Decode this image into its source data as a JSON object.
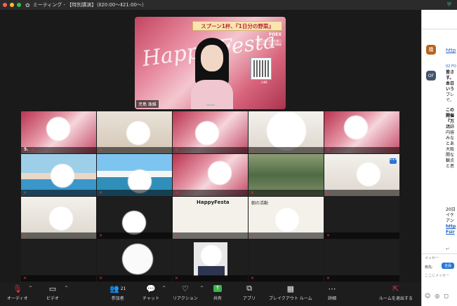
{
  "window": {
    "title": "ミーティング - 【特別講演】（Ⅱ20:00〜Ⅱ21:00〜）"
  },
  "speaker": {
    "banner": "スプーン1杯、『1日分の野菜』",
    "script_text": "Happy Festa",
    "brand": "FOEX",
    "dates": [
      "毎月第1第3金曜日",
      "18:00〜22:00開催"
    ],
    "qr_label": "LINE",
    "name": "児島 珠維"
  },
  "grid": {
    "tiles": [
      {
        "name": "",
        "label": "5.",
        "mic": "muted"
      },
      {
        "name": "",
        "mic": "muted"
      },
      {
        "name": "",
        "mic": "muted"
      },
      {
        "name": "",
        "mic": "muted"
      },
      {
        "name": "",
        "mic": "muted"
      },
      {
        "name": "",
        "mic": "muted"
      },
      {
        "name": "",
        "mic": "muted"
      },
      {
        "name": "",
        "mic": "muted"
      },
      {
        "name": "",
        "mic": "muted"
      },
      {
        "name": "",
        "mic": "muted",
        "menu": "•••"
      },
      {
        "name": "",
        "mic": "muted"
      },
      {
        "name": "",
        "mic": "muted"
      },
      {
        "name": "",
        "mic": "muted",
        "poster": "HappyFesta"
      },
      {
        "name": "",
        "mic": "muted",
        "poster": "朝の活動"
      },
      {
        "name": "",
        "mic": "muted"
      },
      {
        "name": "",
        "mic": "muted"
      },
      {
        "name": "",
        "mic": "muted"
      },
      {
        "name": "",
        "mic": "muted"
      },
      {
        "name": "",
        "mic": "muted"
      },
      {
        "name": "",
        "mic": "muted"
      }
    ]
  },
  "toolbar": {
    "audio": "オーディオ",
    "video": "ビデオ",
    "participants": "参加者",
    "participants_count": "21",
    "chat": "チャット",
    "reaction": "リアクション",
    "share": "共有",
    "apps": "アプリ",
    "breakout": "ブレイクアウト ルーム",
    "details": "詳細",
    "leave": "ルームを退出する"
  },
  "sidebar": {
    "link_top": "http",
    "avatar1": "橋",
    "avatar2": "OF",
    "time_label": "02 FO",
    "msg_lines": [
      "皆さ",
      "す。",
      "本日",
      "いう",
      "ブレ",
      "で、"
    ],
    "msg2_lines": [
      "この",
      "開催",
      "『万",
      "講師",
      "内容",
      "みな",
      "とあ",
      "大阪",
      "開な",
      "観点",
      "と思"
    ],
    "msg3_lines": [
      "20日",
      "イケ",
      "アン"
    ],
    "link_bottom": "http",
    "link_bottom2": "Fsir",
    "composer_label": "メッセー",
    "send_to_label": "宛先:",
    "send_to_value": "全員",
    "input_placeholder": "ここにメッセー"
  },
  "colors": {
    "toolbar_bg": "#1d1d1d",
    "stage_bg": "#1a1a1a",
    "muted": "#e33333",
    "share_green": "#3bb54a",
    "leave_red": "#e0324b",
    "zoom_blue": "#2a75d8"
  }
}
